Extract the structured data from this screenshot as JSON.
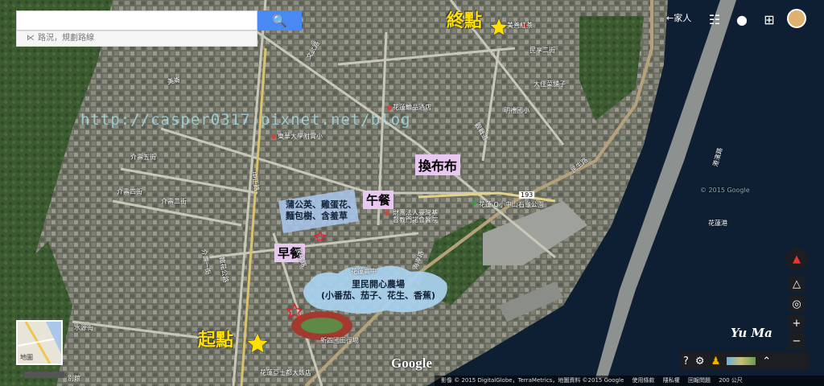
{
  "search": {
    "value": "",
    "route_label": "路況，規劃路線"
  },
  "header": {
    "home_label": "←家人"
  },
  "labels": {
    "end": "終點",
    "start": "起點",
    "breakfast": "早餐",
    "lunch": "午餐",
    "fabric": "換布布",
    "watermark": "http://casper0317.pixnet.net/blog",
    "trees_line1": "蒲公英、雞蛋花、",
    "trees_line2": "麵包樹、含羞草",
    "farm_line1": "里民開心農場",
    "farm_line2": "(小番茄、茄子、花生、香蕉)",
    "signature": "Yu Ma"
  },
  "map_labels": {
    "l1": "美善紅茶",
    "l2": "花蓮輪品酒店",
    "l3": "東華大學附實小",
    "l4": "文武路",
    "l5": "介壽五街",
    "l6": "介壽四街",
    "l7": "介壽二街",
    "l8": "民權路",
    "l9": "花蓮高中",
    "l10": "花蓮港",
    "l11": "花蓮 Q小中山石龜公園",
    "l12": "財團法人臺灣基督教門諾會醫院",
    "l13": "新四國田徑場",
    "l14": "花蓮亞士都大飯店",
    "l15": "港濱路",
    "l16": "水源街",
    "l17": "明禮國小",
    "l18": "大佳菜舖子",
    "l19": "海岸路",
    "l20": "民享二街",
    "l21": "民生路",
    "l22": "觀戰道",
    "l23": "中正路",
    "l24": "鐵花公路",
    "l25": "介壽一街",
    "l26": "別館",
    "l27": "美崙",
    "l28": "© 2015 Google",
    "l29": "193"
  },
  "footer": {
    "items": [
      "影像 © 2015 DigitalGlobe，TerraMetrics，地圖資料 ©2015 Google",
      "使用條款",
      "隱私權",
      "回報問題",
      "200 公尺"
    ]
  },
  "minimap_label": "地圖",
  "google": "Google",
  "colors": {
    "sea": "#0e1e33",
    "land": "#4f5a48",
    "search_button": "#4a89f3",
    "star": "#ffe000"
  }
}
